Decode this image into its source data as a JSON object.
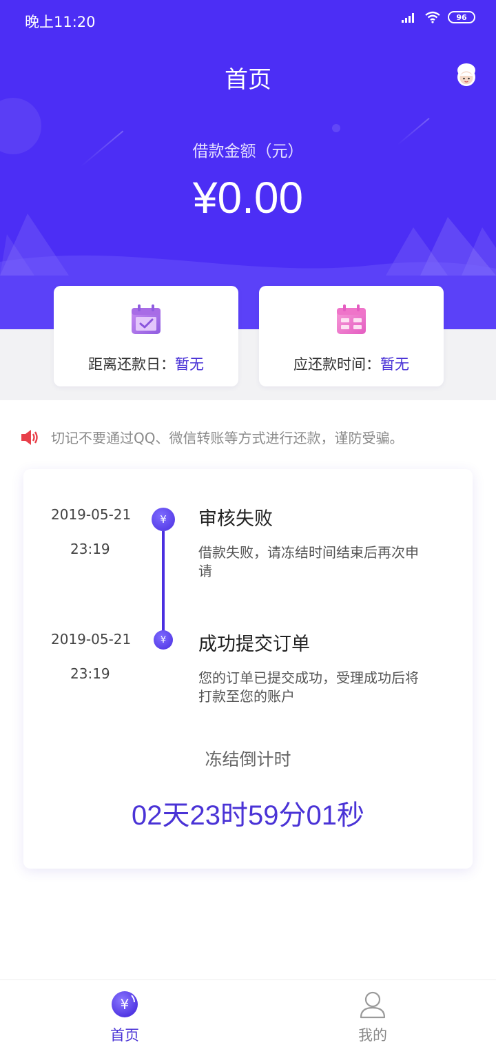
{
  "status_bar": {
    "time": "晚上11:20",
    "battery": "96"
  },
  "header": {
    "title": "首页"
  },
  "loan": {
    "amount_label": "借款金额（元）",
    "amount": "¥0.00"
  },
  "cards": [
    {
      "label": "距离还款日：",
      "value": "暂无",
      "icon": "calendar-check-icon"
    },
    {
      "label": "应还款时间：",
      "value": "暂无",
      "icon": "calendar-grid-icon"
    }
  ],
  "notice": {
    "text": "切记不要通过QQ、微信转账等方式进行还款，谨防受骗。",
    "icon": "speaker-icon"
  },
  "timeline": [
    {
      "date": "2019-05-21",
      "time": "23:19",
      "title": "审核失败",
      "desc": "借款失败，请冻结时间结束后再次申请"
    },
    {
      "date": "2019-05-21",
      "time": "23:19",
      "title": "成功提交订单",
      "desc": "您的订单已提交成功，受理成功后将打款至您的账户"
    }
  ],
  "countdown": {
    "label": "冻结倒计时",
    "value": "02天23时59分01秒"
  },
  "tabbar": {
    "home": "首页",
    "mine": "我的"
  },
  "colors": {
    "primary": "#4c2ef5",
    "accent_text": "#4a33d6",
    "notice_red": "#e8404a"
  }
}
